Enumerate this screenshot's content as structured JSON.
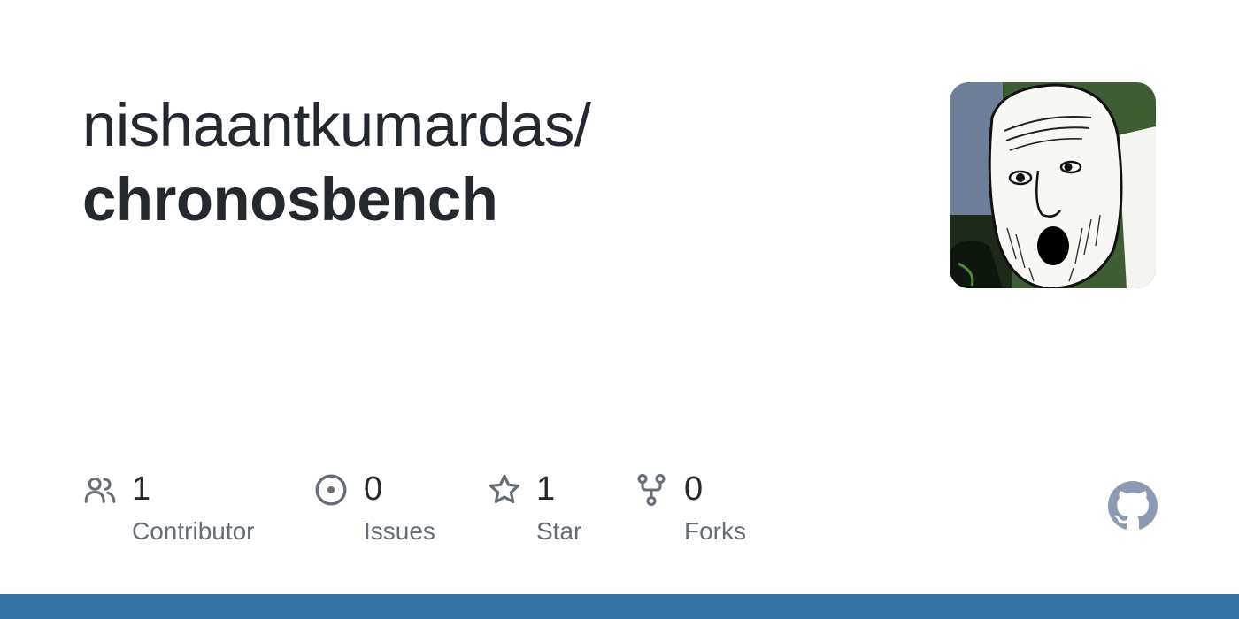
{
  "repo": {
    "owner": "nishaantkumardas/",
    "name": "chronosbench"
  },
  "avatar": {
    "icon": "owner-avatar-sketch-face"
  },
  "stats": [
    {
      "icon": "people-icon",
      "value": "1",
      "label": "Contributor"
    },
    {
      "icon": "issue-opened-icon",
      "value": "0",
      "label": "Issues"
    },
    {
      "icon": "star-icon",
      "value": "1",
      "label": "Star"
    },
    {
      "icon": "repo-forked-icon",
      "value": "0",
      "label": "Forks"
    }
  ],
  "brand": {
    "icon": "github-mark-icon"
  },
  "colors": {
    "text": "#24292f",
    "muted": "#656d76",
    "icon": "#656d76",
    "github_mark": "#8c9bb3",
    "bottom_bar": "#3572a5"
  }
}
